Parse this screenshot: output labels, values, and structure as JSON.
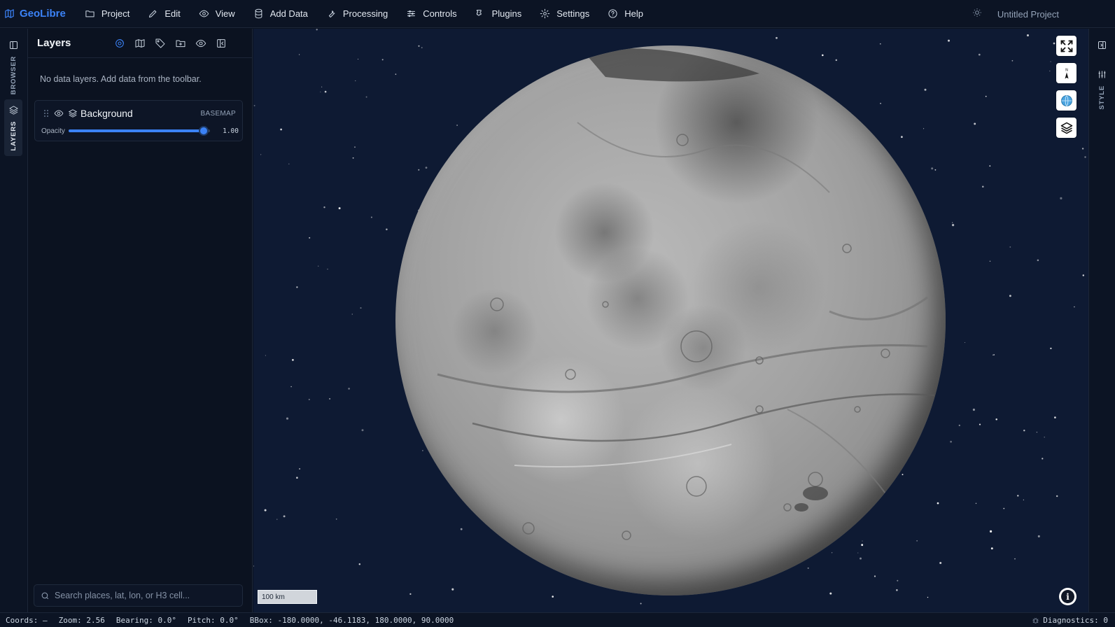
{
  "app": {
    "brand": "GeoLibre",
    "project_title": "Untitled Project"
  },
  "menu": [
    {
      "label": "Project",
      "icon": "folder-icon"
    },
    {
      "label": "Edit",
      "icon": "pencil-icon"
    },
    {
      "label": "View",
      "icon": "eye-icon"
    },
    {
      "label": "Add Data",
      "icon": "database-icon"
    },
    {
      "label": "Processing",
      "icon": "wrench-icon"
    },
    {
      "label": "Controls",
      "icon": "sliders-icon"
    },
    {
      "label": "Plugins",
      "icon": "puzzle-icon"
    },
    {
      "label": "Settings",
      "icon": "gear-icon"
    },
    {
      "label": "Help",
      "icon": "help-circle-icon"
    }
  ],
  "left_rail": {
    "browser_label": "BROWSER",
    "layers_label": "LAYERS"
  },
  "layers_panel": {
    "title": "Layers",
    "tools": [
      "globe-projection-icon",
      "map-icon",
      "tag-icon",
      "folder-plus-icon",
      "eye-icon",
      "collapse-panel-icon"
    ],
    "empty_message": "No data layers. Add data from the toolbar.",
    "layers": [
      {
        "name": "Background",
        "badge": "BASEMAP",
        "opacity_label": "Opacity",
        "opacity": 1.0,
        "opacity_text": "1.00"
      }
    ],
    "search_placeholder": "Search places, lat, lon, or H3 cell..."
  },
  "map": {
    "scale_label": "100 km",
    "controls": [
      "fullscreen-icon",
      "compass-icon",
      "globe-icon",
      "layers-icon"
    ],
    "info_label": "i"
  },
  "right_rail": {
    "style_label": "STYLE"
  },
  "status": {
    "coords": "Coords: —",
    "zoom": "Zoom: 2.56",
    "bearing": "Bearing: 0.0°",
    "pitch": "Pitch: 0.0°",
    "bbox": "BBox: -180.0000, -46.1183, 180.0000, 90.0000",
    "diagnostics": "Diagnostics: 0"
  },
  "colors": {
    "accent": "#3b82f6",
    "background": "#0b1220",
    "map_space": "#0e1a33"
  }
}
